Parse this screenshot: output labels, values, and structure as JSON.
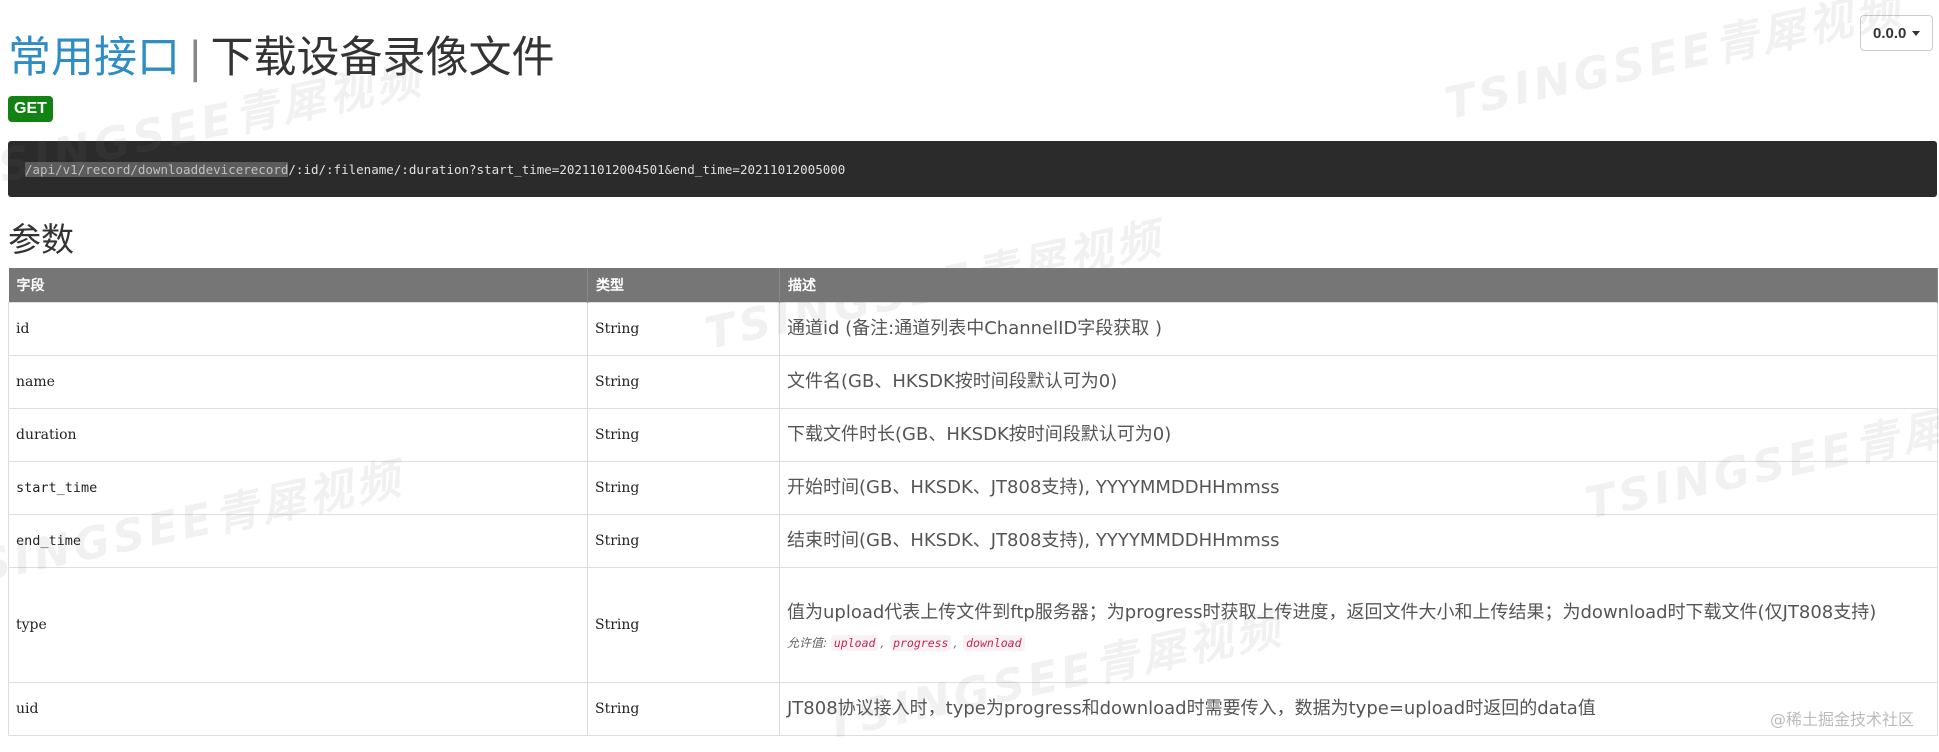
{
  "version": {
    "label": "0.0.0"
  },
  "title": {
    "group": "常用接口",
    "separator": "|",
    "name": "下载设备录像文件"
  },
  "method": "GET",
  "url": {
    "highlighted": "/api/v1/record/downloaddevicerecord",
    "rest": "/:id/:filename/:duration?start_time=20211012004501&end_time=20211012005000"
  },
  "section": {
    "params_heading": "参数"
  },
  "table": {
    "headers": {
      "field": "字段",
      "type": "类型",
      "desc": "描述"
    },
    "rows": [
      {
        "field": "id",
        "type": "String",
        "desc": "通道id (备注:通道列表中ChannelID字段获取 )"
      },
      {
        "field": "name",
        "type": "String",
        "desc": "文件名(GB、HKSDK按时间段默认可为0)"
      },
      {
        "field": "duration",
        "type": "String",
        "desc": "下载文件时长(GB、HKSDK按时间段默认可为0)"
      },
      {
        "field": "start_time",
        "type": "String",
        "desc": "开始时间(GB、HKSDK、JT808支持), YYYYMMDDHHmmss"
      },
      {
        "field": "end_time",
        "type": "String",
        "desc": "结束时间(GB、HKSDK、JT808支持), YYYYMMDDHHmmss"
      },
      {
        "field": "type",
        "type": "String",
        "desc": "值为upload代表上传文件到ftp服务器；为progress时获取上传进度，返回文件大小和上传结果；为download时下载文件(仅JT808支持)",
        "allowed_label": "允许值:",
        "allowed_values": [
          "upload",
          "progress",
          "download"
        ]
      },
      {
        "field": "uid",
        "type": "String",
        "desc": "JT808协议接入时，type为progress和download时需要传入，数据为type=upload时返回的data值"
      }
    ]
  },
  "watermark": {
    "text": "TSINGSEE青犀视频"
  },
  "credit": "@稀土掘金技术社区"
}
